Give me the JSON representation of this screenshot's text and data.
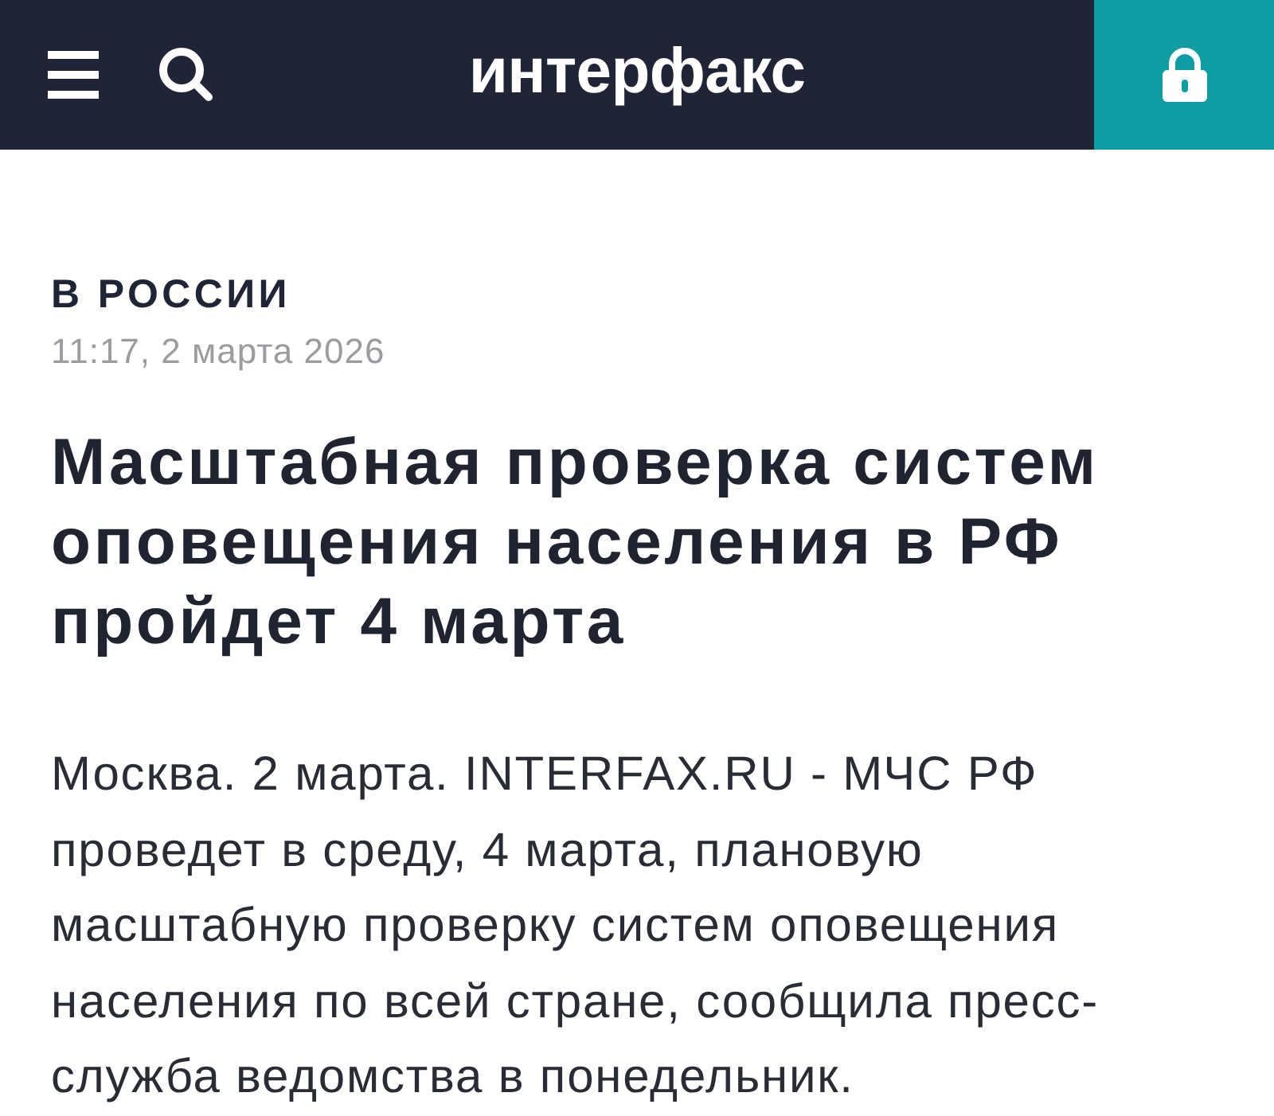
{
  "header": {
    "logo": "интерфакс"
  },
  "article": {
    "category": "В РОССИИ",
    "published": "11:17, 2 марта 2026",
    "headline": "Масштабная проверка систем оповещения населения в РФ пройдет 4 марта",
    "lead": "Москва. 2 марта. INTERFAX.RU - МЧС РФ проведет в среду, 4 марта, плановую масштабную проверку систем оповещения населения по всей стране, сообщила пресс-служба ведомства в понедельник."
  }
}
